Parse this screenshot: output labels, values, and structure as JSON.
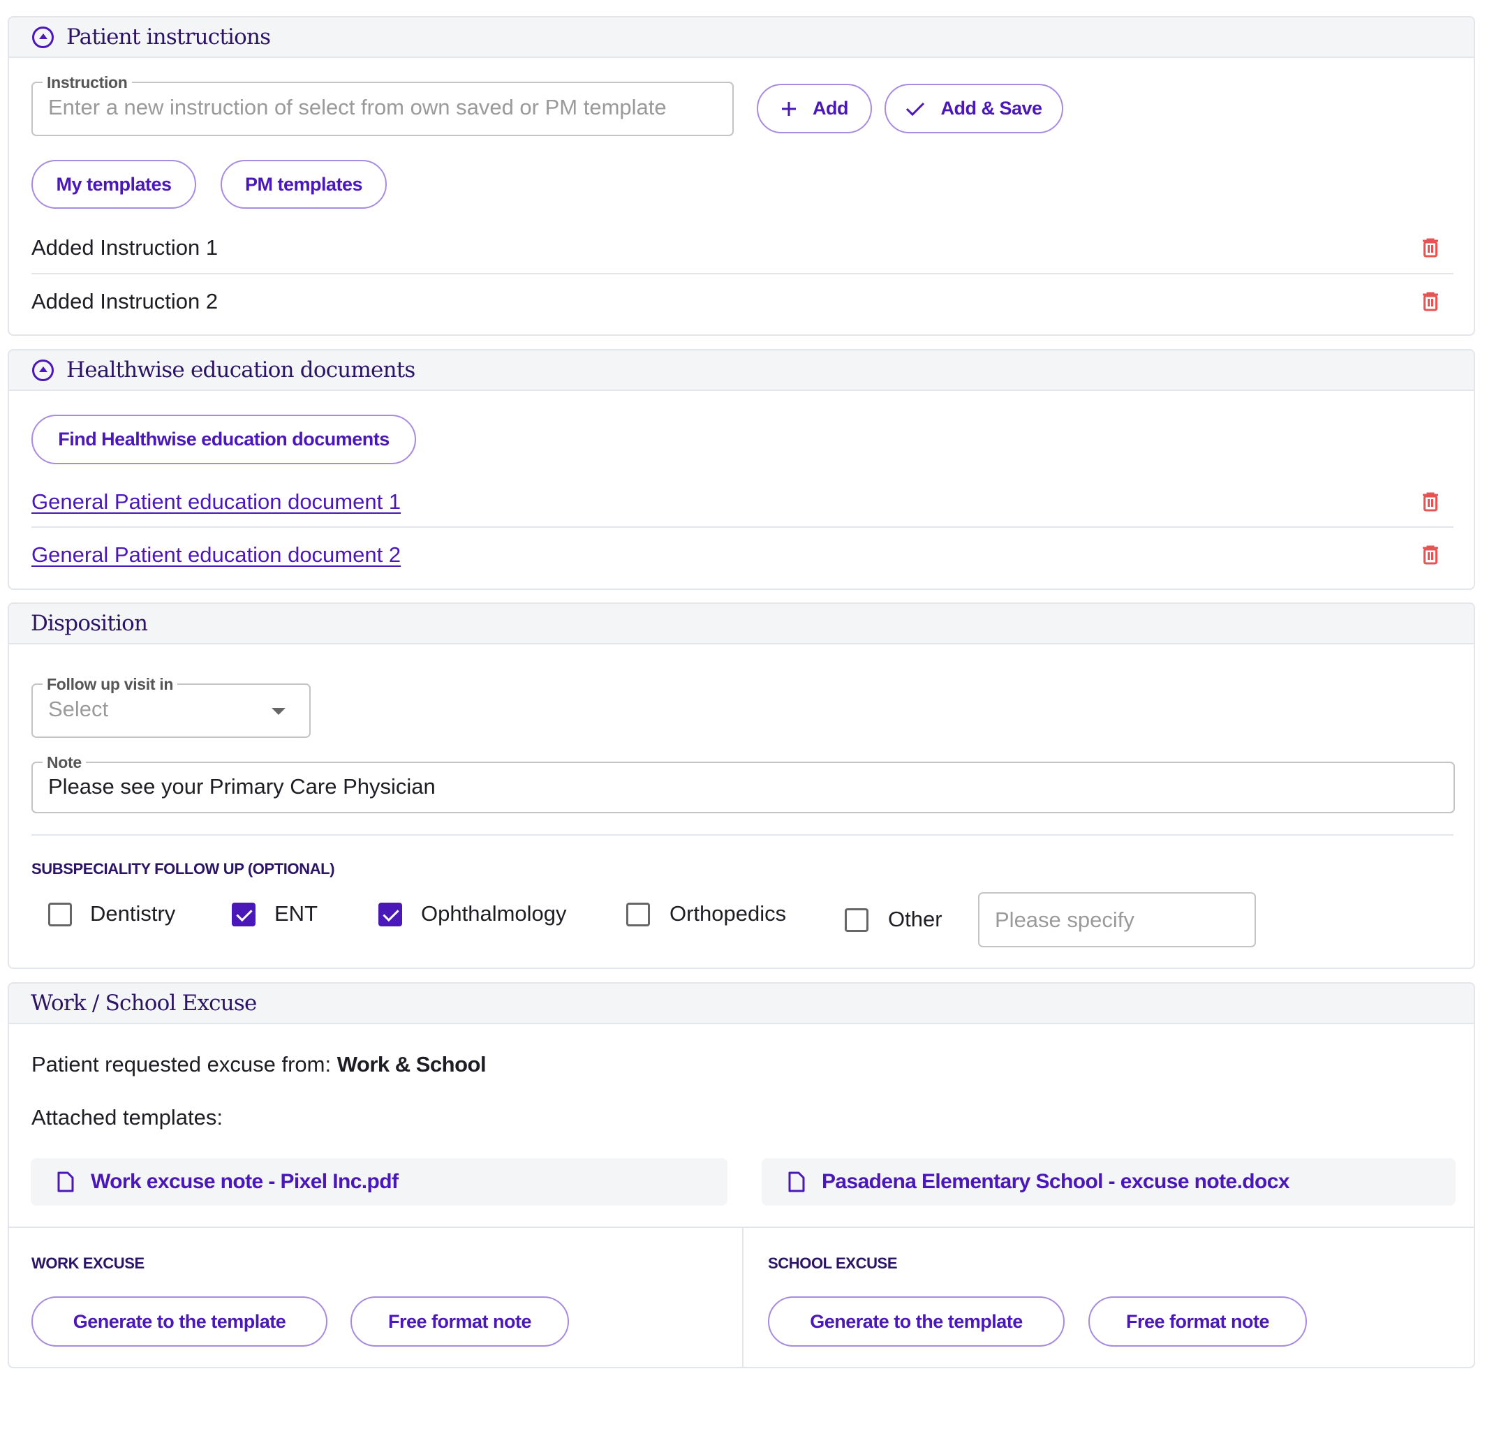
{
  "colors": {
    "accent": "#4a18b8",
    "heading": "#2b1466",
    "danger": "#e55353",
    "header_bg": "#f4f5f7",
    "border": "#e2e5ea"
  },
  "patient_instructions": {
    "title": "Patient instructions",
    "collapse_icon": "chevron-up-circle-icon",
    "instruction_field": {
      "label": "Instruction",
      "placeholder": "Enter a new instruction of select from own saved or PM template",
      "value": ""
    },
    "add_button": {
      "label": "Add",
      "icon": "plus-icon"
    },
    "add_save_button": {
      "label": "Add & Save",
      "icon": "check-icon"
    },
    "my_templates_button": "My templates",
    "pm_templates_button": "PM templates",
    "items": [
      {
        "text": "Added Instruction 1",
        "icon": "trash-icon"
      },
      {
        "text": "Added Instruction 2",
        "icon": "trash-icon"
      }
    ]
  },
  "healthwise": {
    "title": "Healthwise education documents",
    "collapse_icon": "chevron-up-circle-icon",
    "find_button": "Find Healthwise education documents",
    "documents": [
      {
        "text": "General Patient education document 1",
        "icon": "trash-icon"
      },
      {
        "text": "General Patient education document 2",
        "icon": "trash-icon"
      }
    ]
  },
  "disposition": {
    "title": "Disposition",
    "follow_up": {
      "label": "Follow up visit in",
      "placeholder": "Select",
      "value": ""
    },
    "note": {
      "label": "Note",
      "value": "Please see your Primary Care Physician"
    },
    "subspeciality_label": "SUBSPECIALITY  FOLLOW UP (OPTIONAL)",
    "options": [
      {
        "label": "Dentistry",
        "checked": false
      },
      {
        "label": "ENT",
        "checked": true
      },
      {
        "label": "Ophthalmology",
        "checked": true
      },
      {
        "label": "Orthopedics",
        "checked": false
      },
      {
        "label": "Other",
        "checked": false
      }
    ],
    "other_specify": {
      "placeholder": "Please specify",
      "value": ""
    }
  },
  "excuse": {
    "title": "Work / School Excuse",
    "requested_prefix": "Patient requested excuse from: ",
    "requested_value": "Work & School",
    "attached_label": "Attached templates:",
    "attachments": [
      {
        "name": "Work excuse note - Pixel Inc.pdf",
        "icon": "document-icon"
      },
      {
        "name": "Pasadena Elementary School - excuse note.docx",
        "icon": "document-icon"
      }
    ],
    "work": {
      "label": "WORK EXCUSE",
      "generate_button": "Generate to the template",
      "free_button": "Free format note"
    },
    "school": {
      "label": "SCHOOL EXCUSE",
      "generate_button": "Generate to the template",
      "free_button": "Free format note"
    }
  }
}
